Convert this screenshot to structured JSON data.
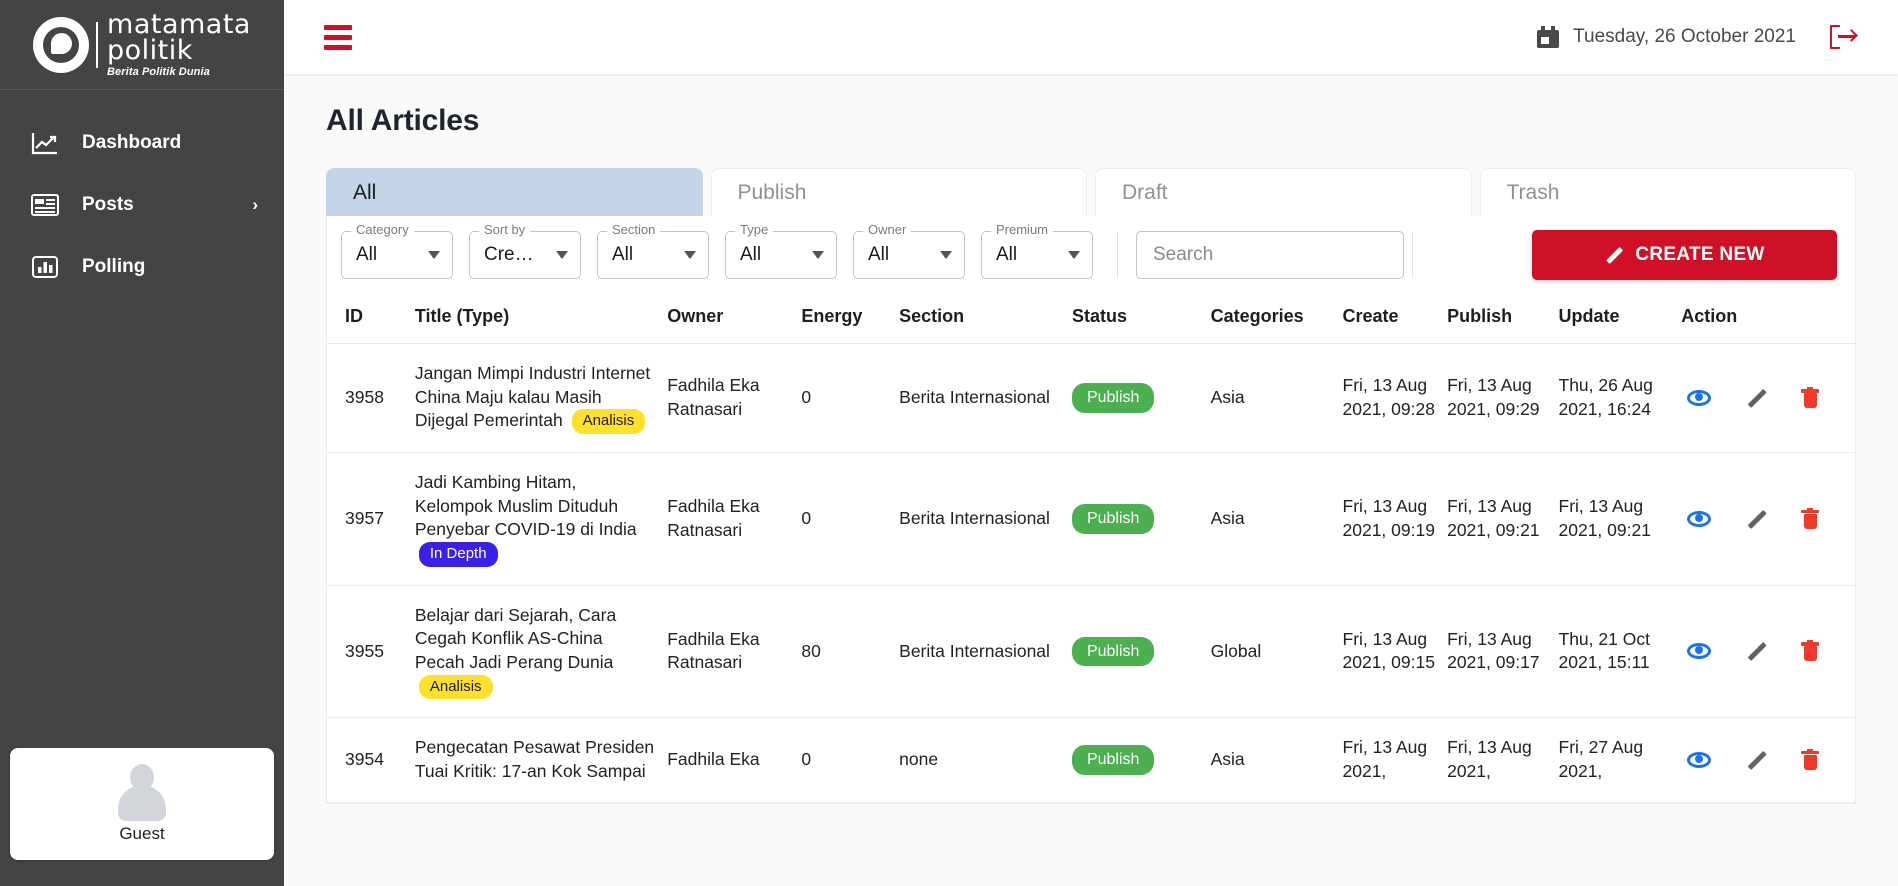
{
  "sidebar": {
    "brand": {
      "line1": "matamata",
      "line2": "politik",
      "tagline": "Berita Politik Dunia"
    },
    "items": [
      {
        "label": "Dashboard",
        "icon": "chart-line-icon"
      },
      {
        "label": "Posts",
        "icon": "newspaper-icon",
        "chevron": "›"
      },
      {
        "label": "Polling",
        "icon": "bar-chart-icon"
      }
    ],
    "user": {
      "name": "Guest"
    }
  },
  "topbar": {
    "menu_icon": "hamburger-icon",
    "calendar_icon": "calendar-icon",
    "date": "Tuesday, 26 October 2021",
    "logout_icon": "logout-icon"
  },
  "page": {
    "title": "All Articles"
  },
  "tabs": [
    {
      "label": "All",
      "active": true
    },
    {
      "label": "Publish",
      "active": false
    },
    {
      "label": "Draft",
      "active": false
    },
    {
      "label": "Trash",
      "active": false
    }
  ],
  "filters": [
    {
      "label": "Category",
      "value": "All"
    },
    {
      "label": "Sort by",
      "value": "Cre…"
    },
    {
      "label": "Section",
      "value": "All"
    },
    {
      "label": "Type",
      "value": "All"
    },
    {
      "label": "Owner",
      "value": "All"
    },
    {
      "label": "Premium",
      "value": "All"
    }
  ],
  "search": {
    "value": "",
    "placeholder": "Search"
  },
  "create_button": {
    "label": "CREATE NEW",
    "icon": "pencil-icon",
    "color": "#cf1127"
  },
  "table": {
    "columns": [
      "ID",
      "Title (Type)",
      "Owner",
      "Energy",
      "Section",
      "Status",
      "Categories",
      "Create",
      "Publish",
      "Update",
      "Action"
    ],
    "rows": [
      {
        "id": "3958",
        "title": "Jangan Mimpi Industri Internet China Maju kalau Masih Dijegal Pemerintah",
        "type_badge": "Analisis",
        "type_badge_style": "analisis",
        "owner": "Fadhila Eka Ratnasari",
        "energy": "0",
        "section": "Berita Internasional",
        "status": "Publish",
        "categories": "Asia",
        "create": "Fri, 13 Aug 2021, 09:28",
        "publish": "Fri, 13 Aug 2021, 09:29",
        "update": "Thu, 26 Aug 2021, 16:24"
      },
      {
        "id": "3957",
        "title": "Jadi Kambing Hitam, Kelompok Muslim Dituduh Penyebar COVID-19 di India",
        "type_badge": "In Depth",
        "type_badge_style": "indepth",
        "owner": "Fadhila Eka Ratnasari",
        "energy": "0",
        "section": "Berita Internasional",
        "status": "Publish",
        "categories": "Asia",
        "create": "Fri, 13 Aug 2021, 09:19",
        "publish": "Fri, 13 Aug 2021, 09:21",
        "update": "Fri, 13 Aug 2021, 09:21"
      },
      {
        "id": "3955",
        "title": "Belajar dari Sejarah, Cara Cegah Konflik AS-China Pecah Jadi Perang Dunia",
        "type_badge": "Analisis",
        "type_badge_style": "analisis",
        "owner": "Fadhila Eka Ratnasari",
        "energy": "80",
        "section": "Berita Internasional",
        "status": "Publish",
        "categories": "Global",
        "create": "Fri, 13 Aug 2021, 09:15",
        "publish": "Fri, 13 Aug 2021, 09:17",
        "update": "Thu, 21 Oct 2021, 15:11"
      },
      {
        "id": "3954",
        "title": "Pengecatan Pesawat Presiden Tuai Kritik: 17-an Kok Sampai",
        "type_badge": "",
        "type_badge_style": "",
        "owner": "Fadhila Eka",
        "energy": "0",
        "section": "none",
        "status": "Publish",
        "categories": "Asia",
        "create": "Fri, 13 Aug 2021,",
        "publish": "Fri, 13 Aug 2021,",
        "update": "Fri, 27 Aug 2021,"
      }
    ],
    "action_icons": [
      "eye-icon",
      "pencil-icon",
      "trash-icon"
    ]
  },
  "colors": {
    "brand_red": "#cf1127",
    "sidebar_bg": "#444444",
    "tab_active_bg": "#c3d4e8",
    "status_publish": "#4caf50",
    "badge_analisis": "#ffe12b",
    "badge_indepth": "#3a21e8"
  }
}
